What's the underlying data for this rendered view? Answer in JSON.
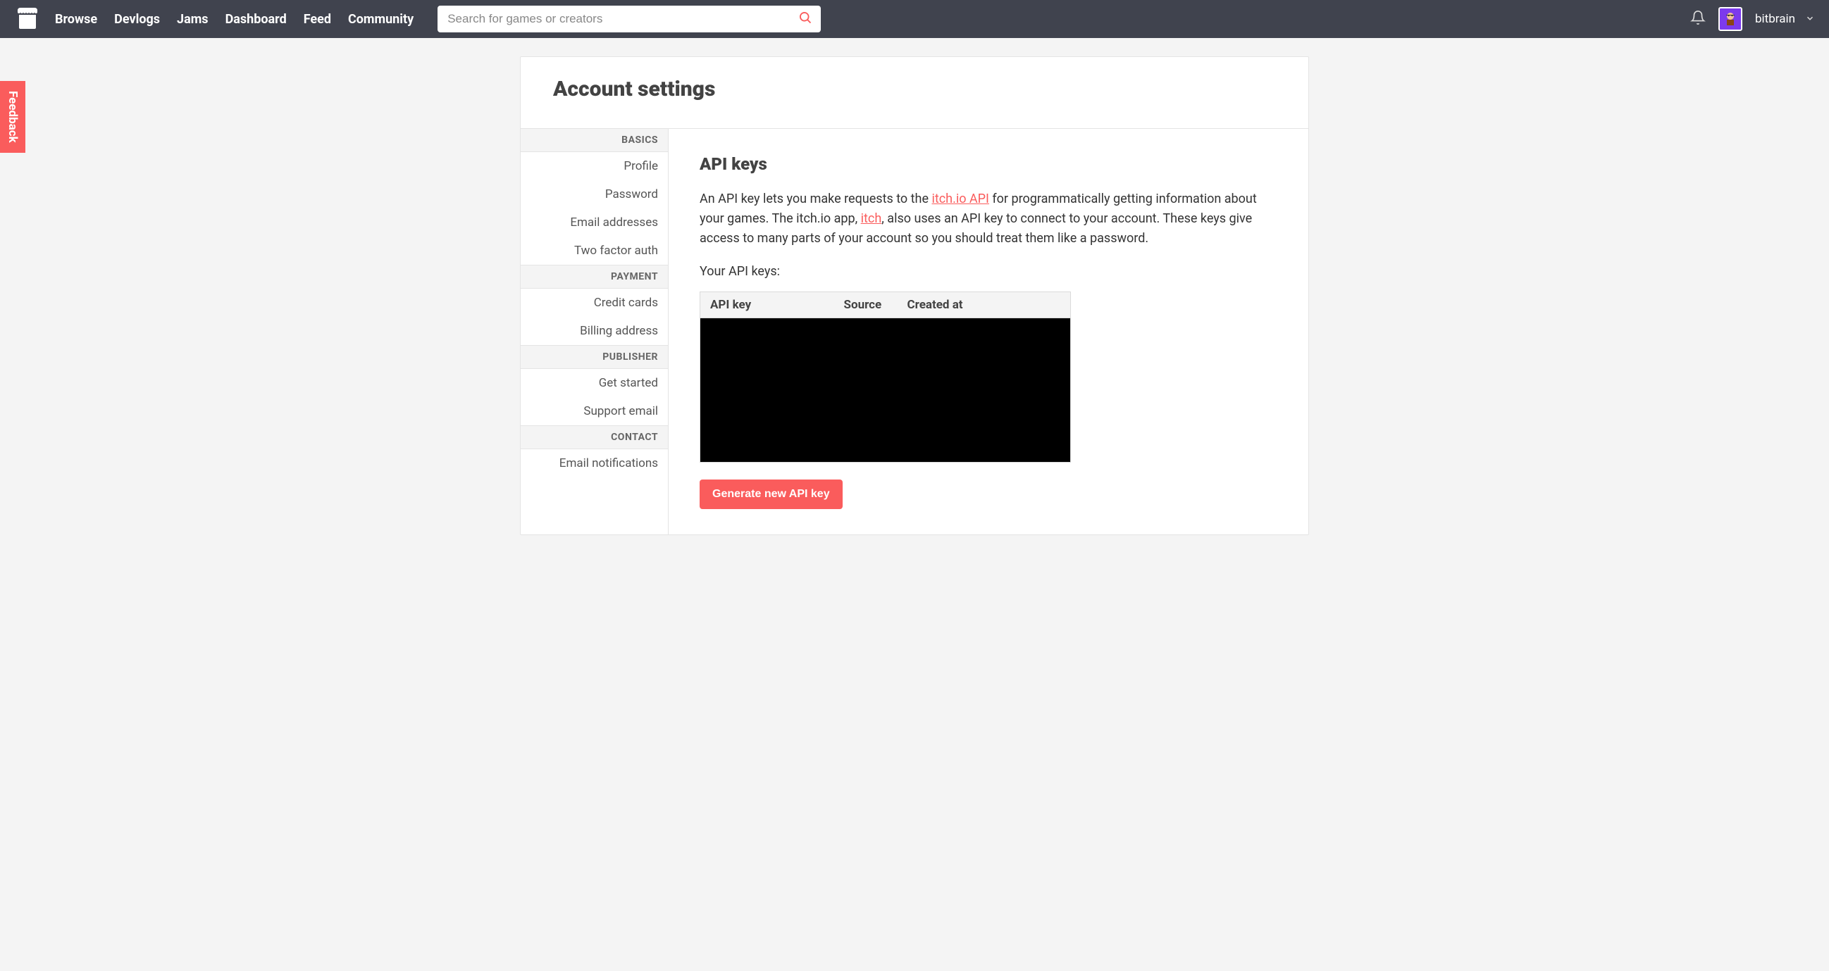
{
  "nav": {
    "links": [
      "Browse",
      "Devlogs",
      "Jams",
      "Dashboard",
      "Feed",
      "Community"
    ],
    "search_placeholder": "Search for games or creators",
    "username": "bitbrain"
  },
  "feedback_label": "Feedback",
  "page_title": "Account settings",
  "sidebar": {
    "sections": [
      {
        "header": "BASICS",
        "items": [
          "Profile",
          "Password",
          "Email addresses",
          "Two factor auth"
        ]
      },
      {
        "header": "PAYMENT",
        "items": [
          "Credit cards",
          "Billing address"
        ]
      },
      {
        "header": "PUBLISHER",
        "items": [
          "Get started",
          "Support email"
        ]
      },
      {
        "header": "CONTACT",
        "items": [
          "Email notifications"
        ]
      }
    ]
  },
  "main": {
    "section_title": "API keys",
    "desc_part1": "An API key lets you make requests to the ",
    "desc_link1": "itch.io API",
    "desc_part2": " for programmatically getting information about your games. The itch.io app, ",
    "desc_link2": "itch",
    "desc_part3": ", also uses an API key to connect to your account. These keys give access to many parts of your account so you should treat them like a password.",
    "subheading": "Your API keys:",
    "table_headers": [
      "API key",
      "Source",
      "Created at"
    ],
    "generate_btn": "Generate new API key"
  }
}
